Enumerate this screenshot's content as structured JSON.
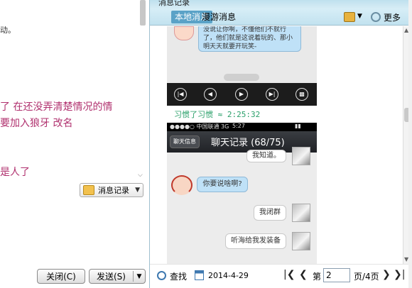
{
  "chat_pane": {
    "lines": {
      "line3": "了 在还没弄清楚情况的情",
      "line4": "要加入狼牙 改名",
      "line5": "是人了"
    },
    "partial_line": "动。",
    "history_button": {
      "label": "消息记录"
    },
    "close_button": "关闭(C)",
    "send_button": "发送(S)"
  },
  "history_window": {
    "title": "消息记录",
    "tabs": [
      "本地消息",
      "漫游消息"
    ],
    "more_label": "更多",
    "message": {
      "bubble_text": "没说让你啊，不懂他们不就行了，他们就是这说着玩的、那小明天天就要开玩笑-",
      "timestamp": "",
      "sender": "习惯了习惯 ≈ 2:25:32"
    },
    "screenshot2": {
      "carrier": "●●●●○ 中国联通  3G",
      "time": "5:27",
      "back_label": "聊天信息",
      "title": "聊天记录 (68/75)",
      "msg1": "我知道。",
      "msg2": "你要说啥啊?",
      "msg3": "我闭群",
      "msg4": "听海给我发装备"
    },
    "footer": {
      "find_label": "查找",
      "date": "2014-4-29",
      "page_prefix": "第",
      "page_value": "2",
      "page_suffix": "页/4页"
    }
  },
  "colors": {
    "accent_tab": "#5aa2c7",
    "chat_pink": "#b0306e",
    "sender_green": "#2aa06a"
  },
  "icons": [
    "history-icon",
    "toolbar-icon",
    "more-icon",
    "search-icon",
    "calendar-icon",
    "first-page-icon",
    "prev-page-icon",
    "next-page-icon",
    "last-page-icon"
  ]
}
